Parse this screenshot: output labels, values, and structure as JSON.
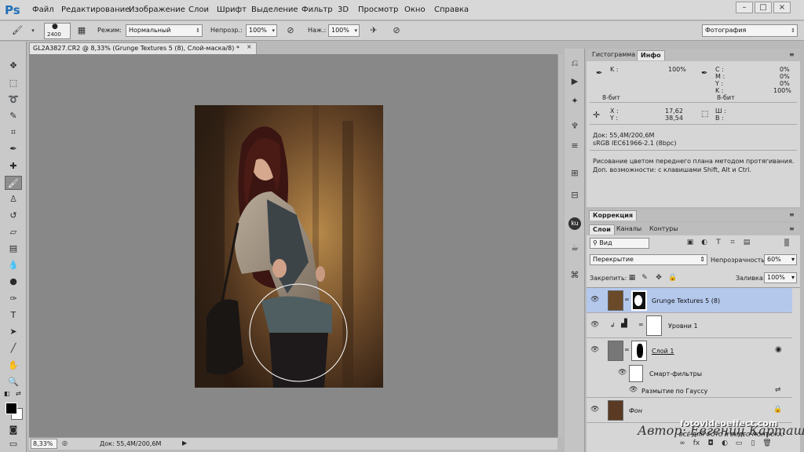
{
  "app": {
    "logo": "Ps"
  },
  "menu": [
    "Файл",
    "Редактирование",
    "Изображение",
    "Слои",
    "Шрифт",
    "Выделение",
    "Фильтр",
    "3D",
    "Просмотр",
    "Окно",
    "Справка"
  ],
  "window_controls": {
    "minimize": "–",
    "maximize": "□",
    "close": "×"
  },
  "options_bar": {
    "brush_size": "2400",
    "mode_label": "Режим:",
    "mode_value": "Нормальный",
    "opacity_label": "Непрозр.:",
    "opacity_value": "100%",
    "pressure_label": "Наж.:",
    "pressure_value": "100%",
    "workspace_value": "Фотография"
  },
  "document": {
    "tab_title": "GL2A3827.CR2 @ 8,33% (Grunge Textures 5 (8), Слой-маска/8) *",
    "close": "×"
  },
  "status": {
    "zoom": "8,33%",
    "doc_size": "Док: 55,4M/200,6M"
  },
  "info_panel": {
    "tabs": [
      "Гистограмма",
      "Инфо"
    ],
    "k_label": "K :",
    "k_value": "100%",
    "cmyk_labels": [
      "C :",
      "M :",
      "Y :",
      "K :"
    ],
    "cmyk_values": [
      "0%",
      "0%",
      "0%",
      "100%"
    ],
    "bit_left": "8-бит",
    "bit_right": "8-бит",
    "x_label": "X :",
    "x_value": "17,62",
    "y_label": "Y :",
    "y_value": "38,54",
    "w_label": "Ш :",
    "h_label": "В :",
    "doc_line1": "Док: 55,4M/200,6M",
    "doc_line2": "sRGB IEC61966-2.1 (8bpc)",
    "hint": "Рисование цветом переднего плана методом протягивания. Доп. возможности: с клавишами Shift, Alt и Ctrl."
  },
  "correction_panel": {
    "tab": "Коррекция"
  },
  "layers_panel": {
    "tabs": [
      "Слои",
      "Каналы",
      "Контуры"
    ],
    "filter_value": "Вид",
    "blend_value": "Перекрытие",
    "opacity_label": "Непрозрачность:",
    "opacity_value": "60%",
    "lock_label": "Закрепить:",
    "fill_label": "Заливка:",
    "fill_value": "100%",
    "layers": [
      {
        "name": "Grunge Textures 5 (8)"
      },
      {
        "name": "Уровни 1"
      },
      {
        "name": "Слой 1"
      },
      {
        "name": "Смарт-фильтры"
      },
      {
        "name": "Размытие по Гауссу"
      },
      {
        "name": "Фон"
      }
    ]
  },
  "watermark": {
    "site": "fotovideoeffect.com",
    "tagline": "ВСЁ ДЛЯ ФОТО И ВИДЕО МОНТАЖА!",
    "author": "Автор: Евгений Карташов"
  },
  "colors": {
    "accent": "#1f6fb8",
    "selected_layer": "#b4c8ec"
  }
}
